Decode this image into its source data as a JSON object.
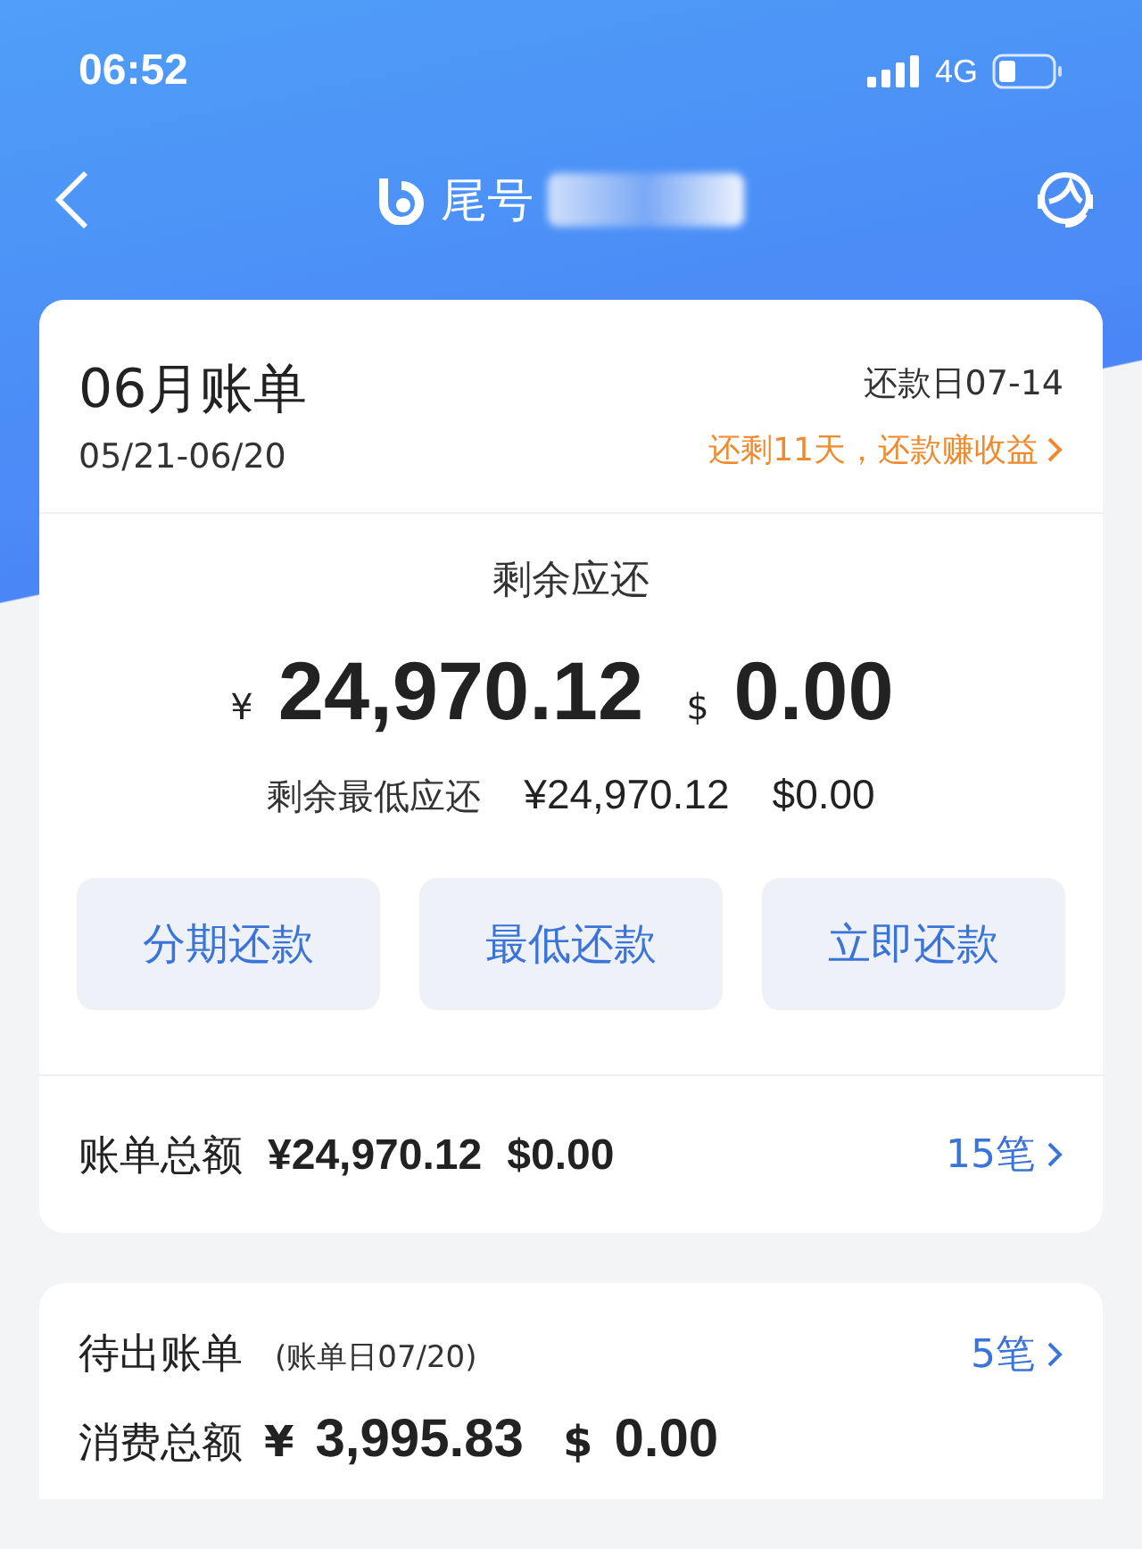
{
  "status_bar": {
    "time": "06:52",
    "network": "4G"
  },
  "nav": {
    "title": "尾号"
  },
  "bill": {
    "title": "06月账单",
    "period": "05/21-06/20",
    "due_date": "还款日07-14",
    "promo": "还剩11天，还款赚收益",
    "remaining_label": "剩余应还",
    "cny_symbol": "¥",
    "cny_amount": "24,970.12",
    "usd_symbol": "$",
    "usd_amount": "0.00",
    "min_label": "剩余最低应还",
    "min_cny": "¥24,970.12",
    "min_usd": "$0.00",
    "buttons": [
      "分期还款",
      "最低还款",
      "立即还款"
    ],
    "total_label": "账单总额",
    "total_cny": "¥24,970.12",
    "total_usd": "$0.00",
    "total_count": "15笔"
  },
  "pending": {
    "title": "待出账单",
    "note": "(账单日07/20)",
    "count": "5笔",
    "spend_label": "消费总额",
    "cny_symbol": "¥",
    "cny_amount": "3,995.83",
    "usd_symbol": "$",
    "usd_amount": "0.00"
  }
}
